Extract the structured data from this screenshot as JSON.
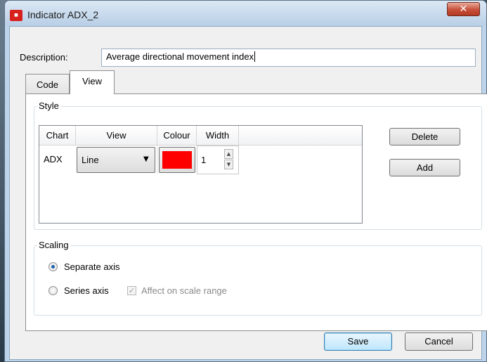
{
  "window": {
    "title": "Indicator ADX_2",
    "icon": "app-logo-icon"
  },
  "form": {
    "description_label": "Description:",
    "description_value": "Average directional movement index"
  },
  "tabs": [
    {
      "label": "Code",
      "active": false
    },
    {
      "label": "View",
      "active": true
    }
  ],
  "style_group": {
    "title": "Style",
    "columns": [
      "Chart",
      "View",
      "Colour",
      "Width"
    ],
    "rows": [
      {
        "chart": "ADX",
        "view": "Line",
        "colour": "#ff0000",
        "width": "1"
      }
    ],
    "delete_label": "Delete",
    "add_label": "Add"
  },
  "scaling_group": {
    "title": "Scaling",
    "separate_axis_label": "Separate axis",
    "separate_axis_checked": true,
    "series_axis_label": "Series axis",
    "series_axis_checked": false,
    "affect_scale_label": "Affect on scale range",
    "affect_scale_checked": true,
    "affect_scale_enabled": false
  },
  "footer": {
    "save_label": "Save",
    "cancel_label": "Cancel"
  },
  "colors": {
    "accent": "#3c7fb1",
    "close_button": "#c7503a",
    "swatch": "#ff0000"
  }
}
